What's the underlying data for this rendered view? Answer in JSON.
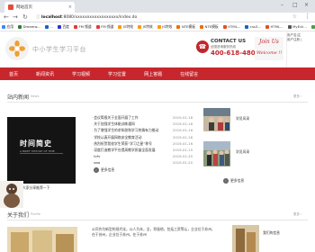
{
  "browser": {
    "tab_title": "网站首页",
    "url_host": "localhost",
    "url_path": ":8080/xxxxxxxxxxxxxxxxxx/index.do",
    "bookmarks": [
      {
        "label": "应用",
        "color": "#4285f4"
      },
      {
        "label": "Dreamw...",
        "color": "#2e7d32"
      },
      {
        "label": "...",
        "color": "#1565c0"
      },
      {
        "label": "百度",
        "color": "#2932e1"
      },
      {
        "label": "FM·频道",
        "color": "#e53935"
      },
      {
        "label": "FM·频道",
        "color": "#e53935"
      },
      {
        "label": "JS特效",
        "color": "#ff9800"
      },
      {
        "label": "JS特效",
        "color": "#ff9800"
      },
      {
        "label": "JS特效",
        "color": "#ff9800"
      },
      {
        "label": "NTE模板",
        "color": "#ef6c00"
      },
      {
        "label": "NTE模板",
        "color": "#ef6c00"
      },
      {
        "label": "HTML...",
        "color": "#e44d26"
      },
      {
        "label": "css3...",
        "color": "#1565c0"
      },
      {
        "label": "HTML...",
        "color": "#e44d26"
      },
      {
        "label": "MyEcli...",
        "color": "#555555"
      },
      {
        "label": "Qui...",
        "color": "#43a047"
      }
    ]
  },
  "site": {
    "name": "中小学生学习平台",
    "contact_title": "CONTACT US",
    "contact_sub": "全国咨询服务热线",
    "phone": "400-618-4800",
    "join_line1": "Join Us",
    "join_line2": "Welcome !!",
    "right_ad": [
      "用户名|注",
      "用户注册 |"
    ]
  },
  "nav": {
    "items": [
      "首页",
      "新闻资讯",
      "学习视频",
      "学习位置",
      "网上答题",
      "在线留言"
    ]
  },
  "news_section": {
    "title": "站内新闻",
    "subtitle": "News",
    "more": "更多 ›",
    "book_small": "",
    "book_title": "时间简史",
    "book_sub": "A BRIEF HISTORY OF TIME",
    "book_caption": "好书推荐和大家分享推荐一下",
    "items": [
      {
        "title": "会议简报关于全面开展了工作",
        "date": "2019-01-18"
      },
      {
        "title": "关于加强学生体能训练通知",
        "date": "2019-01-16"
      },
      {
        "title": "为了增强学生的求知欲和学习热情有力推动",
        "date": "2019-01-16"
      },
      {
        "title": "学校认真开展网络安全教育活动",
        "date": "2019-01-16"
      },
      {
        "title": "热烈祝贺我校学生荣获“学习之星”称号",
        "date": "2019-01-16"
      },
      {
        "title": "深度打造教学平台提高教学质量全面发展",
        "date": "2019-01-15"
      },
      {
        "title": "fvfv",
        "date": "2019-01-20"
      },
      {
        "title": "aaa",
        "date": "2019-01-20"
      }
    ],
    "more_btn": "更多信息",
    "photo1_caption": "学员风采",
    "photo2_caption": "学员风采",
    "photo2_more": "更多信息"
  },
  "video_section": {
    "title": "关于我们",
    "subtitle": "Profile",
    "more": "更多 ›",
    "text": "公司作为新型的现代化，以人为本，全，积极地，包括工资等认，企业位于苏州，在于苏州，企业位于苏州，在于苏州",
    "right_caption": "我们的信息"
  }
}
